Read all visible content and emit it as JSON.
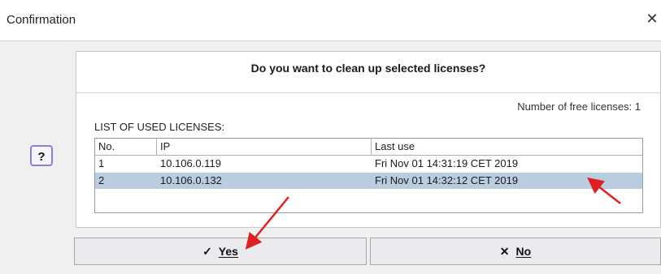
{
  "window": {
    "title": "Confirmation",
    "close_glyph": "✕"
  },
  "help": {
    "label": "?"
  },
  "dialog": {
    "question": "Do you want to clean up selected licenses?",
    "free_licenses": "Number of free licenses: 1",
    "list_label": "LIST OF USED LICENSES:"
  },
  "table": {
    "columns": [
      "No.",
      "IP",
      "Last use"
    ],
    "rows": [
      {
        "no": "1",
        "ip": "10.106.0.119",
        "last_use": "Fri Nov 01 14:31:19 CET 2019",
        "selected": false
      },
      {
        "no": "2",
        "ip": "10.106.0.132",
        "last_use": "Fri Nov 01 14:32:12 CET 2019",
        "selected": true
      }
    ]
  },
  "buttons": {
    "yes": {
      "icon": "✓",
      "label": "Yes"
    },
    "no": {
      "icon": "✕",
      "label": "No"
    }
  },
  "colors": {
    "selected_row": "#b9cde0",
    "annotation_arrow": "#e02020",
    "help_border": "#8a7fd8"
  }
}
